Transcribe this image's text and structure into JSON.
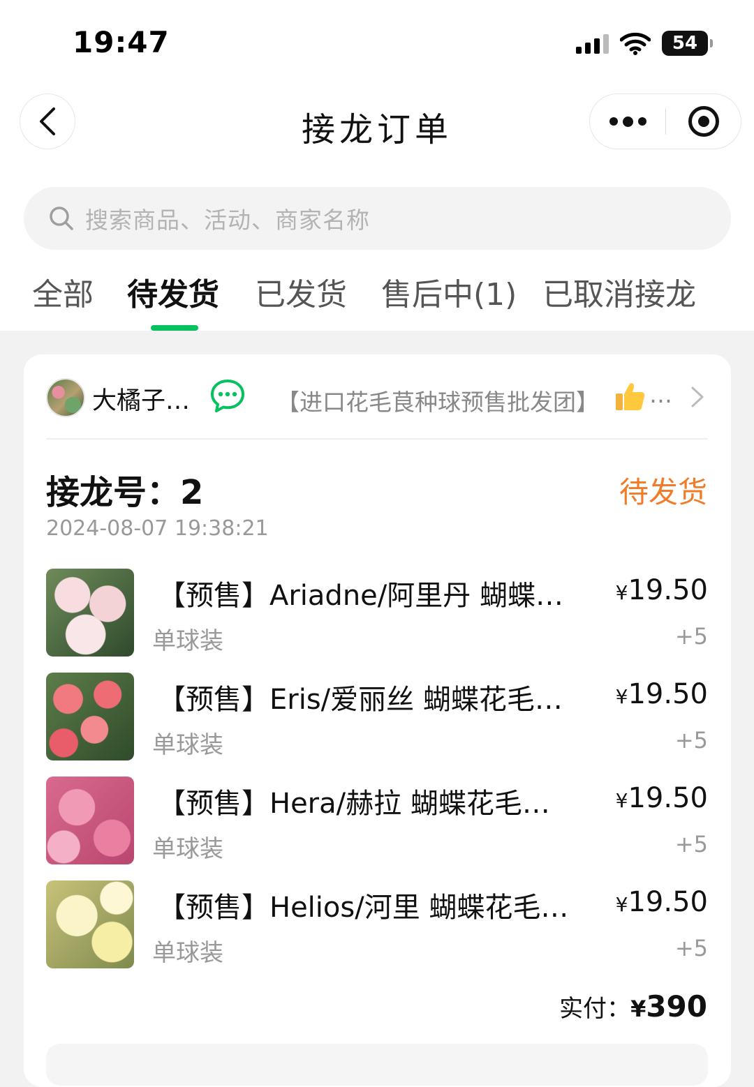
{
  "status_bar": {
    "time": "19:47",
    "battery": "54"
  },
  "nav": {
    "title": "接龙订单"
  },
  "search": {
    "placeholder": "搜索商品、活动、商家名称"
  },
  "tabs": [
    {
      "label": "全部"
    },
    {
      "label": "待发货",
      "active": true
    },
    {
      "label": "已发货"
    },
    {
      "label": "售后中(1)"
    },
    {
      "label": "已取消接龙"
    }
  ],
  "accent_color": "#07c160",
  "status_color": "#f07c2a",
  "order": {
    "shop_name": "大橘子…",
    "group_name": "【进口花毛茛种球预售批发团】",
    "number_label": "接龙号：",
    "number": "2",
    "status": "待发货",
    "time": "2024-08-07 19:38:21",
    "items": [
      {
        "title": "【预售】Ariadne/阿里丹 蝴蝶…",
        "spec": "单球装",
        "price_symbol": "¥",
        "price": "19.50",
        "qty": "+5"
      },
      {
        "title": "【预售】Eris/爱丽丝 蝴蝶花毛…",
        "spec": "单球装",
        "price_symbol": "¥",
        "price": "19.50",
        "qty": "+5"
      },
      {
        "title": "【预售】Hera/赫拉 蝴蝶花毛…",
        "spec": "单球装",
        "price_symbol": "¥",
        "price": "19.50",
        "qty": "+5"
      },
      {
        "title": "【预售】Helios/河里 蝴蝶花毛…",
        "spec": "单球装",
        "price_symbol": "¥",
        "price": "19.50",
        "qty": "+5"
      }
    ],
    "total_label": "实付：",
    "total_symbol": "¥",
    "total_amount": "390"
  }
}
